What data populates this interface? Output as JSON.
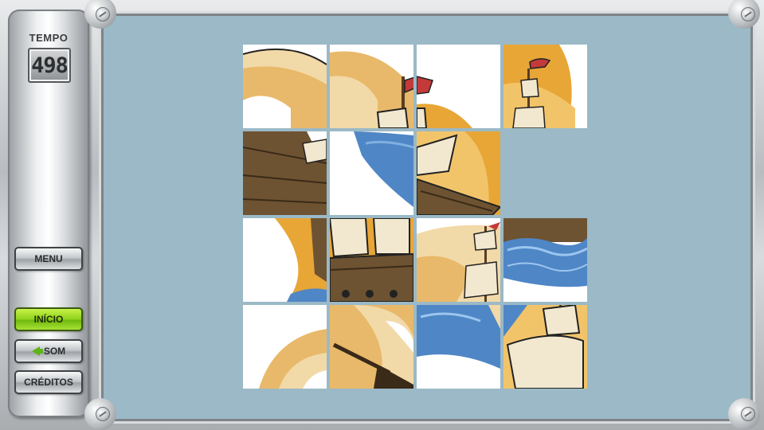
{
  "hud": {
    "tempo_label": "TEMPO",
    "tempo_value": "498"
  },
  "menu": {
    "menu_label": "MENU",
    "inicio_label": "INÍCIO",
    "som_label": "SOM",
    "creditos_label": "CRÉDITOS"
  },
  "colors": {
    "board": "#9bb9c6",
    "active_button": "#8ed11a",
    "sea": "#4f86c6",
    "sail": "#f2e8cf",
    "hull": "#6d5332",
    "sky_orange": "#e8a637",
    "flag": "#c43a3a"
  },
  "puzzle": {
    "columns": 4,
    "rows": 4,
    "empty_slot": 7,
    "tiles": [
      {
        "slot": 0,
        "art": "sun-swirl-left"
      },
      {
        "slot": 1,
        "art": "swirl-flag"
      },
      {
        "slot": 2,
        "art": "white-corner"
      },
      {
        "slot": 3,
        "art": "small-mast-orange"
      },
      {
        "slot": 4,
        "art": "hull-left"
      },
      {
        "slot": 5,
        "art": "sea-wave"
      },
      {
        "slot": 6,
        "art": "sail-hull"
      },
      {
        "slot": 8,
        "art": "orange-curve"
      },
      {
        "slot": 9,
        "art": "sails-deck"
      },
      {
        "slot": 10,
        "art": "mast-sails"
      },
      {
        "slot": 11,
        "art": "waves-hull"
      },
      {
        "slot": 12,
        "art": "swirl-bottom"
      },
      {
        "slot": 13,
        "art": "oar-swirl"
      },
      {
        "slot": 14,
        "art": "blue-sea"
      },
      {
        "slot": 15,
        "art": "big-sail"
      }
    ]
  }
}
